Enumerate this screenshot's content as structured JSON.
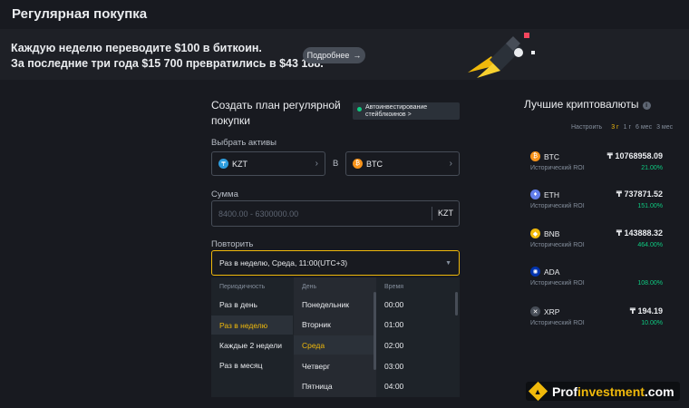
{
  "page": {
    "title": "Регулярная покупка"
  },
  "banner": {
    "line1": "Каждую неделю переводите $100 в биткоин.",
    "line2": "За последние три года $15 700 превратились в $43 188.",
    "more_button": "Подробнее",
    "more_icon": "arrow-right-icon"
  },
  "plan": {
    "title": "Создать план регулярной покупки",
    "auto_invest_badge": "Автоинвестирование стейблкоинов >",
    "select_assets_label": "Выбрать активы",
    "from_asset": "KZT",
    "to_word": "В",
    "to_asset": "BTC",
    "amount_label": "Сумма",
    "amount_placeholder": "8400.00 - 6300000.00",
    "amount_currency": "KZT",
    "repeat_label": "Повторить",
    "repeat_value": "Раз в неделю, Среда, 11:00(UTC+3)"
  },
  "dropdown": {
    "periodicity_header": "Периодичность",
    "periodicity_options": [
      "Раз в день",
      "Раз в неделю",
      "Каждые 2 недели",
      "Раз в месяц"
    ],
    "selected_periodicity": "Раз в неделю",
    "day_header": "День",
    "day_options": [
      "Понедельник",
      "Вторник",
      "Среда",
      "Четверг",
      "Пятница"
    ],
    "selected_day": "Среда",
    "time_header": "Время",
    "time_options": [
      "00:00",
      "01:00",
      "02:00",
      "03:00",
      "04:00"
    ]
  },
  "top_crypto": {
    "title": "Лучшие криптовалюты",
    "configure": "Настроить",
    "periods": [
      "3 г",
      "1 г",
      "6 мес",
      "3 мес"
    ],
    "active_period": "3 г",
    "roi_label": "Исторический ROI",
    "items": [
      {
        "symbol": "BTC",
        "price": "₸ 10768958.09",
        "roi": "21.00%",
        "color": "#f7931a",
        "icon": "btc-icon"
      },
      {
        "symbol": "ETH",
        "price": "₸ 737871.52",
        "roi": "151.00%",
        "color": "#627eea",
        "icon": "eth-icon"
      },
      {
        "symbol": "BNB",
        "price": "₸ 143888.32",
        "roi": "464.00%",
        "color": "#f0b90b",
        "icon": "bnb-icon"
      },
      {
        "symbol": "ADA",
        "price": "",
        "roi": "108.00%",
        "color": "#0033ad",
        "icon": "ada-icon"
      },
      {
        "symbol": "XRP",
        "price": "₸ 194.19",
        "roi": "10.00%",
        "color": "#474d57",
        "icon": "xrp-icon"
      }
    ]
  },
  "watermark": {
    "text": "Profinvestment.com",
    "part1": "Prof",
    "part2": "investment",
    "part3": ".com",
    "accent": "#f0b90b"
  },
  "colors": {
    "accent": "#f0b90b",
    "positive": "#0ecb81",
    "background": "#181a20"
  }
}
